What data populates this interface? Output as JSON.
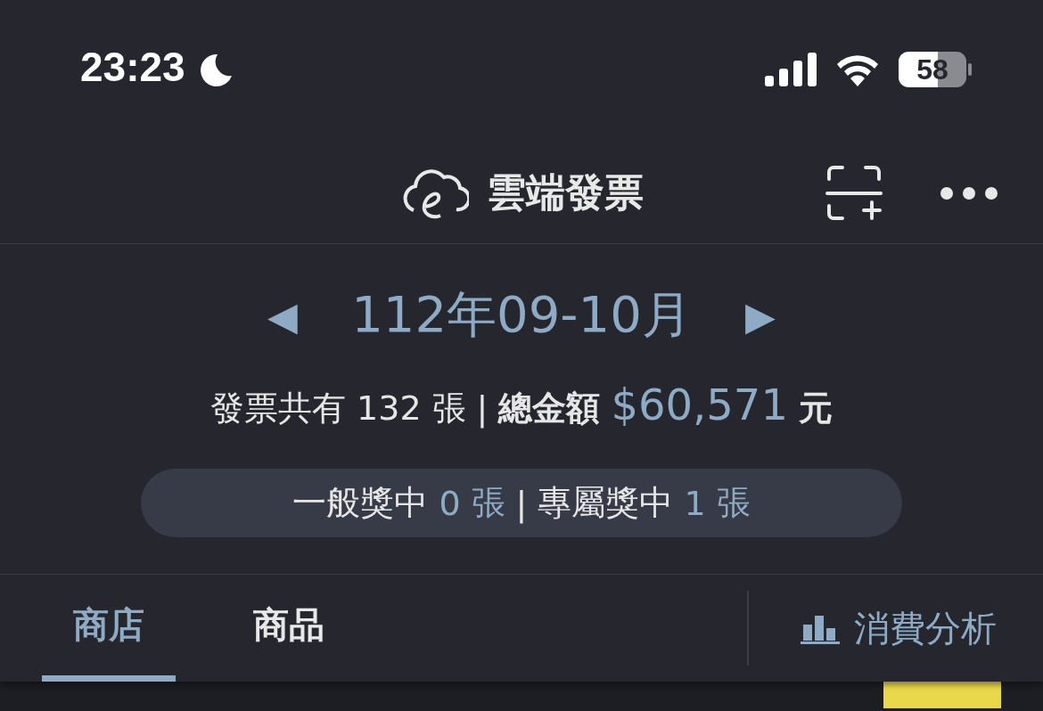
{
  "status_bar": {
    "time": "23:23",
    "battery": "58"
  },
  "header": {
    "title": "雲端發票"
  },
  "period": {
    "label": "112年09-10月",
    "prev": "◀",
    "next": "▶"
  },
  "summary": {
    "count_label": "發票共有",
    "count": "132",
    "count_unit": "張",
    "separator": "|",
    "total_label": "總金額",
    "total": "$60,571",
    "total_unit": "元"
  },
  "prizes": {
    "general_label": "一般獎中",
    "general_count": "0",
    "general_unit": "張",
    "separator": "|",
    "exclusive_label": "專屬獎中",
    "exclusive_count": "1",
    "exclusive_unit": "張"
  },
  "tabs": [
    {
      "label": "商店",
      "selected": true
    },
    {
      "label": "商品",
      "selected": false
    }
  ],
  "analysis_button": {
    "label": "消費分析"
  }
}
